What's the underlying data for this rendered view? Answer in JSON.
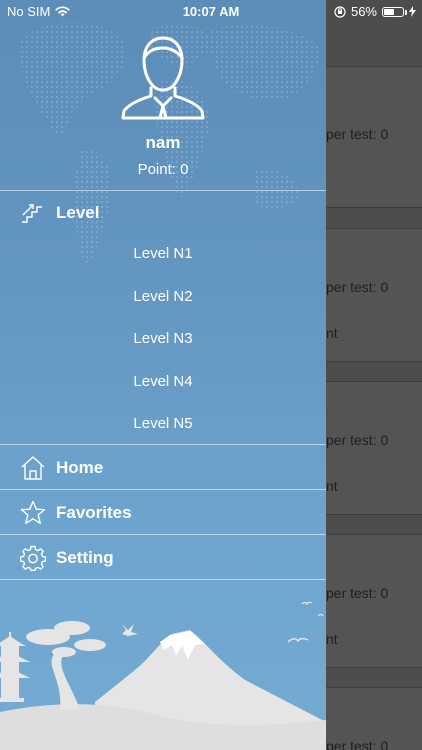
{
  "status_bar": {
    "carrier": "No SIM",
    "time": "10:07 AM",
    "battery": "56%",
    "battery_level": 0.56
  },
  "profile": {
    "name": "nam",
    "points": "Point: 0"
  },
  "menu": {
    "level": {
      "label": "Level",
      "icon": "stairs-icon"
    },
    "levels": [
      "Level N1",
      "Level N2",
      "Level N3",
      "Level N4",
      "Level N5"
    ],
    "home": {
      "label": "Home",
      "icon": "home-icon"
    },
    "favorites": {
      "label": "Favorites",
      "icon": "star-icon"
    },
    "setting": {
      "label": "Setting",
      "icon": "gear-icon"
    }
  },
  "background": {
    "cards": [
      {
        "line1": "per test: 0",
        "line2": ""
      },
      {
        "line1": "per test: 0",
        "line2": "nt"
      },
      {
        "line1": "per test: 0",
        "line2": "nt"
      },
      {
        "line1": "per test: 0",
        "line2": "nt"
      },
      {
        "line1": "per test: 0",
        "line2": ""
      }
    ]
  },
  "colors": {
    "drawer_top": "#5c8cb8",
    "drawer_bottom": "#75abd2",
    "overlay": "#4d4d4d"
  }
}
